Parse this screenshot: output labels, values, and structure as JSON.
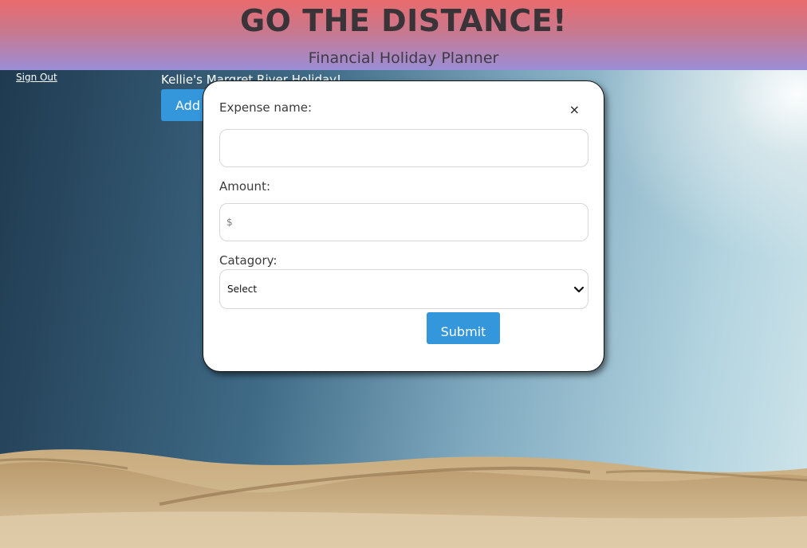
{
  "header": {
    "title": "GO THE DISTANCE!",
    "subtitle": "Financial Holiday Planner"
  },
  "nav": {
    "sign_out": "Sign Out"
  },
  "holiday": {
    "name": "Kellie's Margret River Holiday!",
    "add_button": "Add"
  },
  "modal": {
    "expense_name_label": "Expense name:",
    "expense_name_value": "",
    "amount_label": "Amount:",
    "amount_placeholder": "$",
    "category_label": "Catagory:",
    "category_selected": "Select",
    "submit_label": "Submit",
    "close_symbol": "×"
  },
  "colors": {
    "header_gradient_top": "#e96b6d",
    "header_gradient_bottom": "#9a8ed6",
    "button_blue": "#3497dc",
    "title_text": "#3a3438"
  },
  "icons": {
    "close": "close-icon",
    "chevron": "chevron-down-icon"
  }
}
